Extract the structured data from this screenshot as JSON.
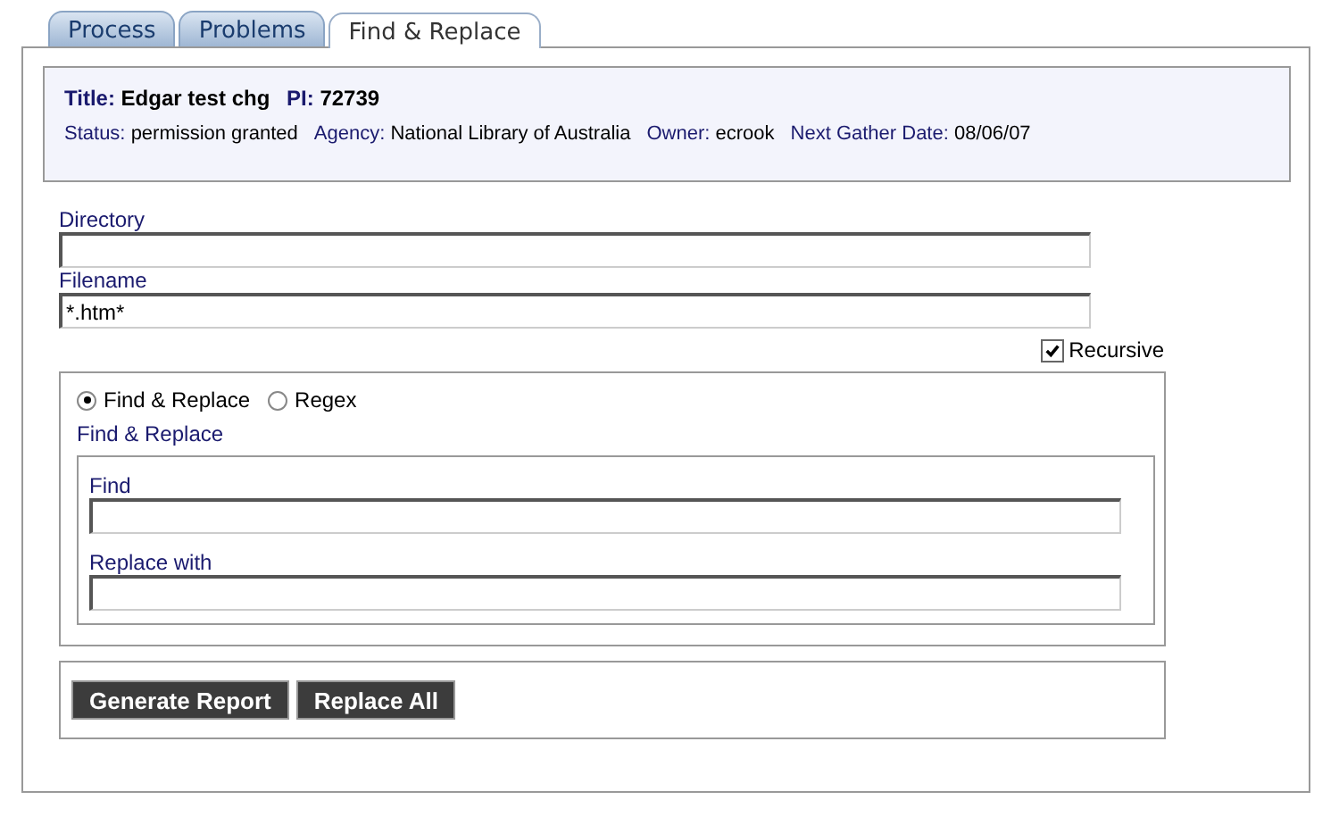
{
  "tabs": [
    {
      "label": "Process",
      "selected": false
    },
    {
      "label": "Problems",
      "selected": false
    },
    {
      "label": "Find & Replace",
      "selected": true
    }
  ],
  "header": {
    "title_label": "Title:",
    "title": "Edgar test chg",
    "pi_label": "PI:",
    "pi": "72739",
    "details": [
      {
        "label": "Status:",
        "value": "permission granted"
      },
      {
        "label": "Agency:",
        "value": "National Library of Australia"
      },
      {
        "label": "Owner:",
        "value": "ecrook"
      },
      {
        "label": "Next Gather Date:",
        "value": "08/06/07"
      }
    ]
  },
  "directory": {
    "label": "Directory"
  },
  "filename": {
    "label": "Filename",
    "value": "*.htm*"
  },
  "recursive": {
    "label": "Recursive",
    "checked": true
  },
  "modes": [
    {
      "label": "Find & Replace",
      "selected": true
    },
    {
      "label": "Regex",
      "selected": false
    }
  ],
  "section_title": "Find & Replace",
  "find": {
    "label": "Find"
  },
  "replace": {
    "label": "Replace with"
  },
  "buttons": [
    "Generate Report",
    "Replace All"
  ]
}
